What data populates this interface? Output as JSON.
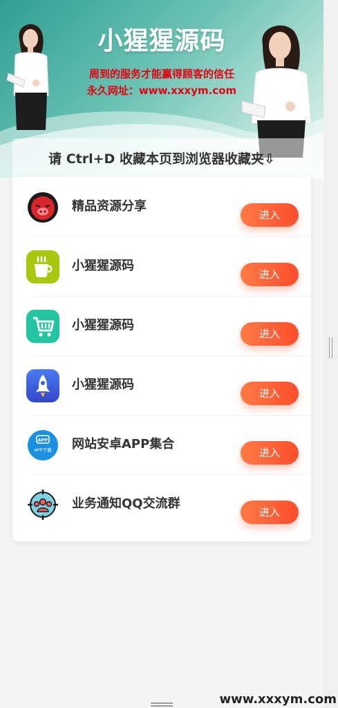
{
  "banner": {
    "title": "小猩猩源码",
    "slogan_line1": "周到的服务才能赢得顾客的信任",
    "slogan_line2": "永久网址：www.xxxym.com"
  },
  "notice": {
    "text": "请 Ctrl+D 收藏本页到浏览器收藏夹⇩"
  },
  "items": [
    {
      "label": "精品资源分享",
      "button": "进入",
      "icon": "pig-face-icon"
    },
    {
      "label": "小猩猩源码",
      "button": "进入",
      "icon": "coffee-cup-icon"
    },
    {
      "label": "小猩猩源码",
      "button": "进入",
      "icon": "shopping-cart-icon"
    },
    {
      "label": "小猩猩源码",
      "button": "进入",
      "icon": "rocket-icon"
    },
    {
      "label": "网站安卓APP集合",
      "button": "进入",
      "icon": "app-download-icon"
    },
    {
      "label": "业务通知QQ交流群",
      "button": "进入",
      "icon": "group-target-icon"
    }
  ],
  "icon_badges": {
    "app_top": "APP",
    "app_bottom": "APP下载"
  },
  "watermark": "www.xxxym.com",
  "colors": {
    "banner_teal": "#3aa89a",
    "button_orange": "#ff5a36",
    "slogan_red": "#e60012"
  }
}
